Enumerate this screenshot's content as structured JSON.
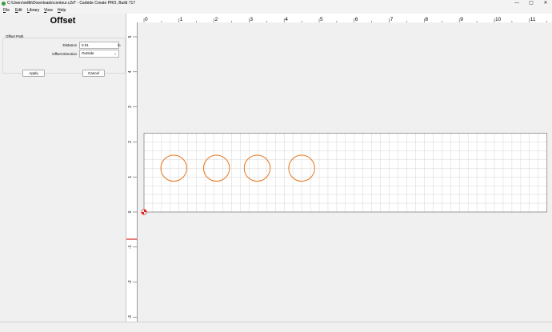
{
  "window": {
    "title": "C:\\Users\\willb\\Downloads\\contour.c2d* - Carbide Create PRO, Build 717",
    "minimize_glyph": "—",
    "maximize_glyph": "▢",
    "close_glyph": "✕"
  },
  "menu": {
    "items": [
      "File",
      "Edit",
      "Library",
      "View",
      "Help"
    ]
  },
  "panel": {
    "title": "Offset",
    "group_label": "Offset Path",
    "distance_label": "Distance",
    "distance_value": "0.01",
    "distance_unit": "in",
    "direction_label": "Offset Direction",
    "direction_value": "Outside",
    "apply_label": "Apply",
    "cancel_label": "Cancel"
  },
  "canvas": {
    "x_ticks": [
      "0",
      "1",
      "2",
      "3",
      "4",
      "5",
      "6",
      "7",
      "8",
      "9",
      "10",
      "11"
    ],
    "y_ticks": [
      "5",
      "4",
      "3",
      "2",
      "1",
      "0",
      "-1",
      "-2",
      "-3"
    ],
    "stock": {
      "width_in": 11.5,
      "height_in": 2.25
    },
    "circles": [
      {
        "cx_in": 0.85,
        "cy_in": 1.25,
        "r_in": 0.37
      },
      {
        "cx_in": 2.07,
        "cy_in": 1.25,
        "r_in": 0.37
      },
      {
        "cx_in": 3.23,
        "cy_in": 1.25,
        "r_in": 0.37
      },
      {
        "cx_in": 4.5,
        "cy_in": 1.25,
        "r_in": 0.37
      }
    ],
    "colors": {
      "shape_stroke": "#e8751a",
      "grid": "#d6d6d6",
      "stock_border": "#7a7a7a",
      "origin": "#e02020"
    }
  }
}
